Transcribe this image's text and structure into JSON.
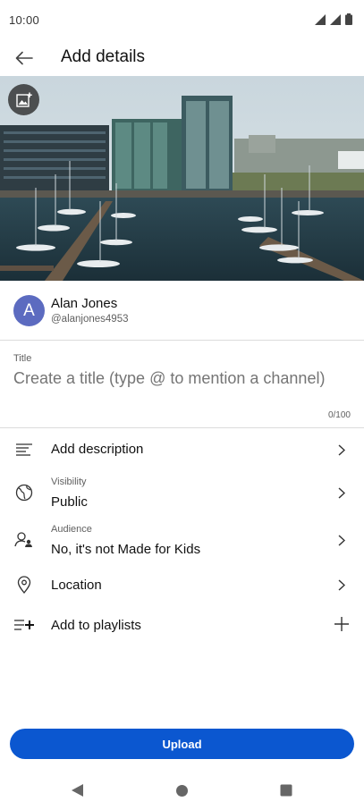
{
  "status_bar": {
    "time": "10:00"
  },
  "app_bar": {
    "title": "Add details"
  },
  "channel": {
    "avatar_letter": "A",
    "name": "Alan Jones",
    "handle": "@alanjones4953"
  },
  "title_field": {
    "label": "Title",
    "value": "",
    "placeholder": "Create a title (type @ to mention a channel)",
    "counter": "0/100"
  },
  "rows": {
    "description": {
      "label": "Add description",
      "icon": "description-lines-icon"
    },
    "visibility": {
      "sublabel": "Visibility",
      "value": "Public",
      "icon": "globe-icon"
    },
    "audience": {
      "sublabel": "Audience",
      "value": "No, it's not Made for Kids",
      "icon": "audience-person-icon"
    },
    "location": {
      "label": "Location",
      "icon": "location-pin-icon"
    },
    "playlists": {
      "label": "Add to playlists",
      "icon": "playlist-add-icon"
    }
  },
  "upload": {
    "label": "Upload",
    "color": "#0b57d0"
  },
  "colors": {
    "avatar": "#5c6bc0",
    "divider": "#dcdcdc"
  }
}
